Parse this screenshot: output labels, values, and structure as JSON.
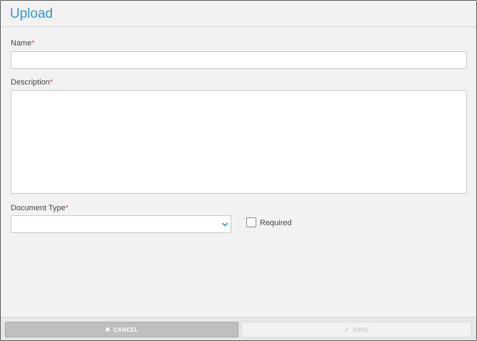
{
  "dialog": {
    "title": "Upload"
  },
  "form": {
    "name": {
      "label": "Name",
      "required_mark": "*",
      "value": ""
    },
    "description": {
      "label": "Description",
      "required_mark": "*",
      "value": ""
    },
    "document_type": {
      "label": "Document Type",
      "required_mark": "*",
      "selected": ""
    },
    "required_checkbox": {
      "label": "Required",
      "checked": false
    }
  },
  "footer": {
    "cancel_label": "CANCEL",
    "cancel_icon": "close-icon",
    "save_label": "SAVE",
    "save_icon": "checkmark-icon",
    "save_enabled": false
  },
  "colors": {
    "accent": "#3a93c5",
    "required": "#d9534f",
    "cancel_bg": "#bfbfbf",
    "save_disabled_text": "#cfcfcf"
  }
}
